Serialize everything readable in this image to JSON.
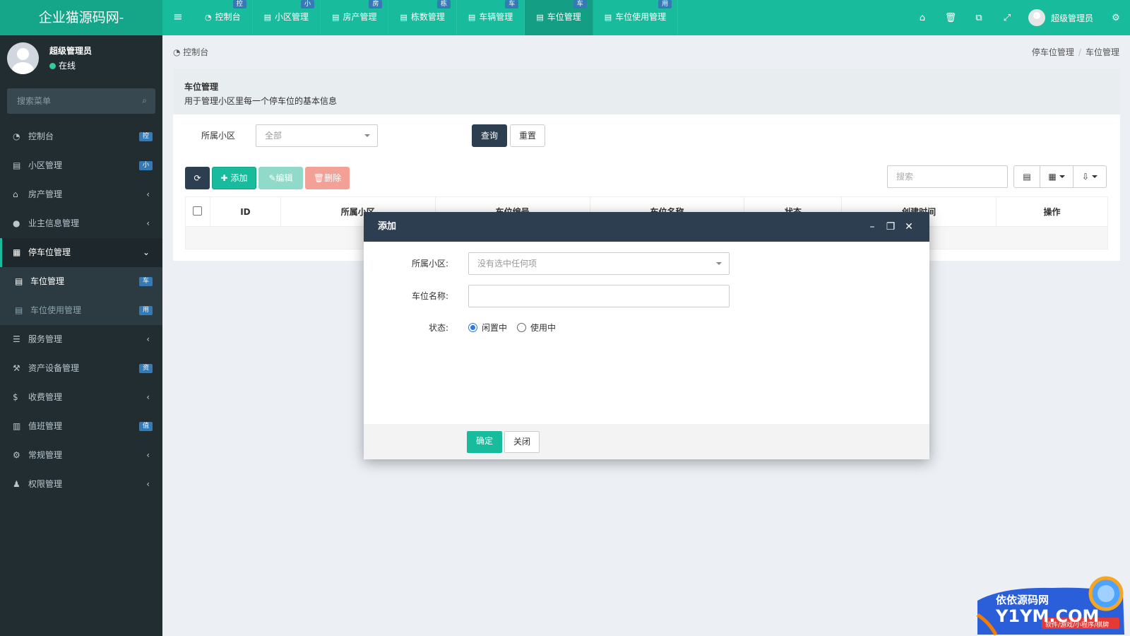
{
  "app": {
    "brand": "企业猫源码网-",
    "top_tabs": [
      {
        "label": "控制台",
        "badge": "控",
        "icon": "dashboard-icon"
      },
      {
        "label": "小区管理",
        "badge": "小",
        "icon": "list-icon"
      },
      {
        "label": "房产管理",
        "badge": "房",
        "icon": "list-icon"
      },
      {
        "label": "栋数管理",
        "badge": "栋",
        "icon": "list-icon"
      },
      {
        "label": "车辆管理",
        "badge": "车",
        "icon": "list-icon"
      },
      {
        "label": "车位管理",
        "badge": "车",
        "icon": "list-icon",
        "active": true
      },
      {
        "label": "车位使用管理",
        "badge": "用",
        "icon": "list-icon"
      }
    ],
    "top_user": "超级管理员"
  },
  "sidebar": {
    "user_name": "超级管理员",
    "user_status": "在线",
    "search_placeholder": "搜索菜单",
    "items": [
      {
        "label": "控制台",
        "icon": "dashboard-icon",
        "badge": "控"
      },
      {
        "label": "小区管理",
        "icon": "list-icon",
        "badge": "小"
      },
      {
        "label": "房产管理",
        "icon": "home-icon",
        "chevron": "‹"
      },
      {
        "label": "业主信息管理",
        "icon": "user-icon",
        "chevron": "‹"
      },
      {
        "label": "停车位管理",
        "icon": "parking-icon",
        "chevron": "⌄",
        "open": true
      },
      {
        "label": "车位管理",
        "icon": "list-icon",
        "badge": "车",
        "sub": true,
        "active": true
      },
      {
        "label": "车位使用管理",
        "icon": "list-icon",
        "badge": "用",
        "sub": true
      },
      {
        "label": "服务管理",
        "icon": "service-icon",
        "chevron": "‹"
      },
      {
        "label": "资产设备管理",
        "icon": "gavel-icon",
        "badge": "资"
      },
      {
        "label": "收费管理",
        "icon": "dollar-icon",
        "chevron": "‹"
      },
      {
        "label": "值班管理",
        "icon": "calendar-icon",
        "badge": "值"
      },
      {
        "label": "常规管理",
        "icon": "cogs-icon",
        "chevron": "‹"
      },
      {
        "label": "权限管理",
        "icon": "group-icon",
        "chevron": "‹"
      }
    ]
  },
  "content": {
    "crumb_left": "控制台",
    "crumb_right": [
      "停车位管理",
      "车位管理"
    ],
    "panel_title": "车位管理",
    "panel_desc": "用于管理小区里每一个停车位的基本信息",
    "filter_label": "所属小区",
    "filter_value": "全部",
    "query_label": "查询",
    "reset_label": "重置",
    "add_label": "添加",
    "edit_label": "编辑",
    "delete_label": "删除",
    "table_search_placeholder": "搜索",
    "columns": [
      "ID",
      "所属小区",
      "车位编号",
      "车位名称",
      "状态",
      "创建时间",
      "操作"
    ]
  },
  "modal": {
    "title": "添加",
    "field_community_label": "所属小区:",
    "field_community_placeholder": "没有选中任何项",
    "field_name_label": "车位名称:",
    "field_status_label": "状态:",
    "status_options": [
      "闲置中",
      "使用中"
    ],
    "status_selected": "闲置中",
    "ok_label": "确定",
    "close_label": "关闭"
  },
  "watermark": {
    "line1": "依依源码网",
    "line2": "Y1YM.COM",
    "line3": "软件/游戏/小程序/棋牌"
  },
  "colors": {
    "primary": "#18bc9c",
    "sidebar": "#222d32",
    "dark": "#2c3e50",
    "badge": "#337ab7"
  }
}
